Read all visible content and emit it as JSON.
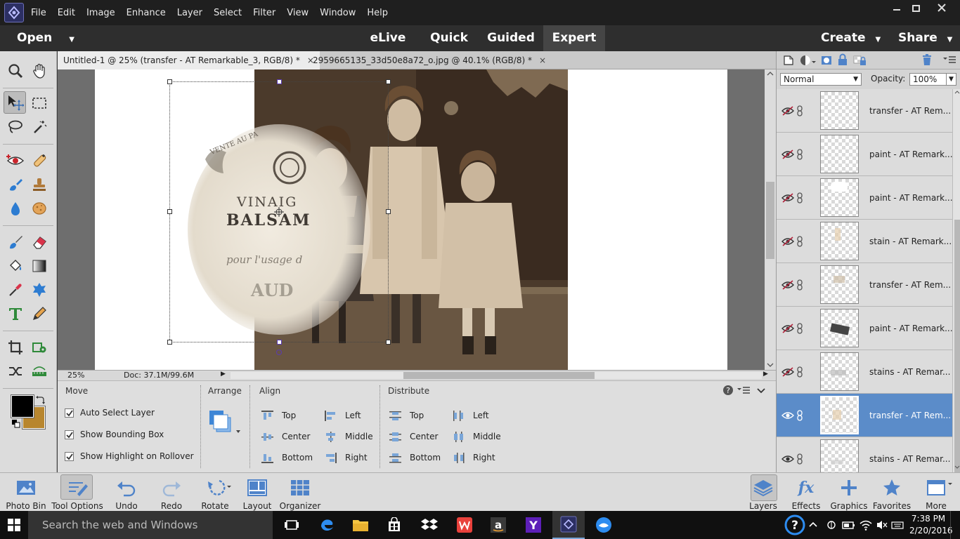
{
  "menu": [
    "File",
    "Edit",
    "Image",
    "Enhance",
    "Layer",
    "Select",
    "Filter",
    "View",
    "Window",
    "Help"
  ],
  "modebar": {
    "open": "Open",
    "modes": [
      "eLive",
      "Quick",
      "Guided",
      "Expert"
    ],
    "active": "Expert",
    "create": "Create",
    "share": "Share"
  },
  "tabs": [
    {
      "title": "Untitled-1 @ 25% (transfer - AT Remarkable_3, RGB/8) *",
      "close": "×"
    },
    {
      "title": "2959665135_33d50e8a72_o.jpg @ 40.1% (RGB/8) *",
      "close": "×"
    }
  ],
  "canvas_art": {
    "l1": "VINAIG",
    "l2": "BALSAM",
    "l3": "pour l'usage d",
    "l4": "AUD",
    "ring": "VENTE AU PA"
  },
  "status": {
    "zoom": "25%",
    "doc": "Doc: 37.1M/99.6M"
  },
  "options": {
    "move": {
      "title": "Move",
      "items": [
        "Auto Select Layer",
        "Show Bounding Box",
        "Show Highlight on Rollover"
      ]
    },
    "arrange": {
      "title": "Arrange"
    },
    "align": {
      "title": "Align",
      "col1": [
        "Top",
        "Center",
        "Bottom"
      ],
      "col2": [
        "Left",
        "Middle",
        "Right"
      ]
    },
    "distribute": {
      "title": "Distribute",
      "col1": [
        "Top",
        "Center",
        "Bottom"
      ],
      "col2": [
        "Left",
        "Middle",
        "Right"
      ]
    }
  },
  "layers": {
    "blend": "Normal",
    "opacity_label": "Opacity:",
    "opacity": "100%",
    "items": [
      {
        "name": "transfer - AT Rem...",
        "visible": false,
        "selected": false
      },
      {
        "name": "paint - AT Remark...",
        "visible": false,
        "selected": false
      },
      {
        "name": "paint - AT Remark...",
        "visible": false,
        "selected": false
      },
      {
        "name": "stain - AT Remark...",
        "visible": false,
        "selected": false
      },
      {
        "name": "transfer - AT Rem...",
        "visible": false,
        "selected": false
      },
      {
        "name": "paint - AT Remark...",
        "visible": false,
        "selected": false
      },
      {
        "name": "stains - AT Remar...",
        "visible": false,
        "selected": false
      },
      {
        "name": "transfer - AT Rem...",
        "visible": true,
        "selected": true
      },
      {
        "name": "stains - AT Remar...",
        "visible": true,
        "selected": false
      }
    ]
  },
  "bottombar": {
    "left": [
      "Photo Bin",
      "Tool Options",
      "Undo",
      "Redo",
      "Rotate",
      "Layout",
      "Organizer"
    ],
    "right": [
      "Layers",
      "Effects",
      "Graphics",
      "Favorites",
      "More"
    ]
  },
  "taskbar": {
    "search": "Search the web and Windows",
    "time": "7:38 PM",
    "date": "2/20/2016"
  },
  "colors": {
    "foreground": "#000000",
    "background": "#b8862e",
    "selected_layer": "#5b8cc9",
    "panel_bg": "#dcdcdc",
    "accent_blue": "#2d7cd1"
  }
}
